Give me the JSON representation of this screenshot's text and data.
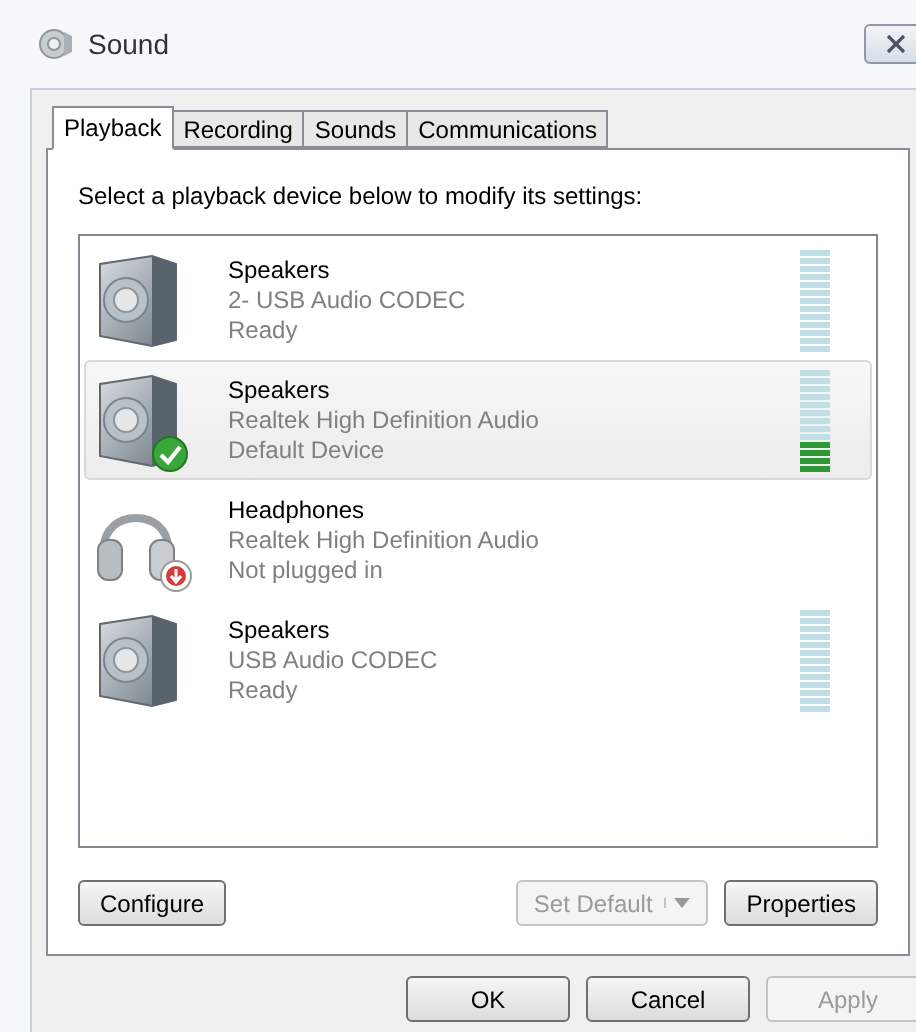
{
  "window": {
    "title": "Sound"
  },
  "tabs": [
    {
      "label": "Playback",
      "selected": true
    },
    {
      "label": "Recording",
      "selected": false
    },
    {
      "label": "Sounds",
      "selected": false
    },
    {
      "label": "Communications",
      "selected": false
    }
  ],
  "instruction": "Select a playback device below to modify its settings:",
  "devices": [
    {
      "kind": "speaker",
      "name": "Speakers",
      "driver": "2- USB Audio CODEC",
      "status": "Ready",
      "selected": false,
      "default": false,
      "unplugged": false,
      "meter": true
    },
    {
      "kind": "speaker",
      "name": "Speakers",
      "driver": "Realtek High Definition Audio",
      "status": "Default Device",
      "selected": true,
      "default": true,
      "unplugged": false,
      "meter": true,
      "level": 0.3
    },
    {
      "kind": "headphones",
      "name": "Headphones",
      "driver": "Realtek High Definition Audio",
      "status": "Not plugged in",
      "selected": false,
      "default": false,
      "unplugged": true,
      "meter": false
    },
    {
      "kind": "speaker",
      "name": "Speakers",
      "driver": "USB Audio CODEC",
      "status": "Ready",
      "selected": false,
      "default": false,
      "unplugged": false,
      "meter": true
    }
  ],
  "panel_buttons": [
    {
      "label": "Configure",
      "disabled": false,
      "kind": "plain"
    },
    {
      "label": "Set Default",
      "disabled": true,
      "kind": "split"
    },
    {
      "label": "Properties",
      "disabled": false,
      "kind": "plain"
    }
  ],
  "dialog_buttons": [
    {
      "label": "OK",
      "disabled": false
    },
    {
      "label": "Cancel",
      "disabled": false
    },
    {
      "label": "Apply",
      "disabled": true
    }
  ]
}
